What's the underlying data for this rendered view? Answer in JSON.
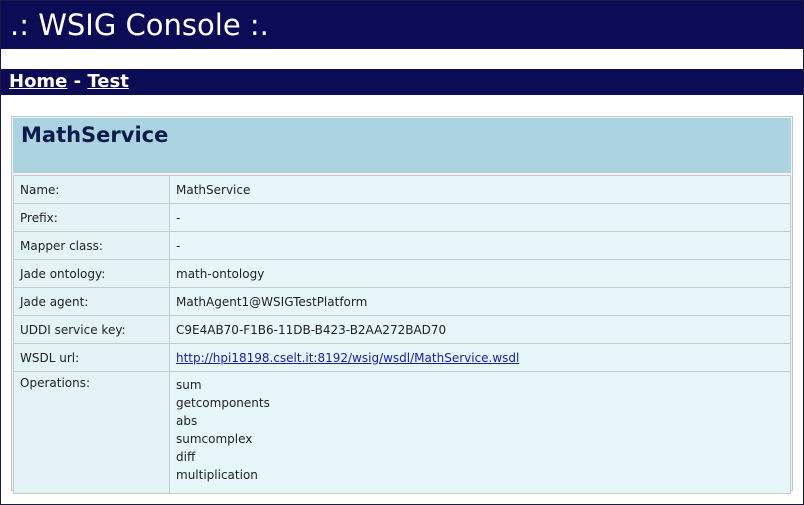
{
  "header": {
    "title": ".: WSIG Console :."
  },
  "nav": {
    "home": "Home",
    "separator": " - ",
    "test": "Test"
  },
  "service": {
    "title": "MathService",
    "rows": [
      {
        "label": "Name:",
        "value": "MathService"
      },
      {
        "label": "Prefix:",
        "value": "-"
      },
      {
        "label": "Mapper class:",
        "value": "-"
      },
      {
        "label": "Jade ontology:",
        "value": "math-ontology"
      },
      {
        "label": "Jade agent:",
        "value": "MathAgent1@WSIGTestPlatform"
      },
      {
        "label": "UDDI service key:",
        "value": "C9E4AB70-F1B6-11DB-B423-B2AA272BAD70"
      },
      {
        "label": "WSDL url:",
        "value": "http://hpi18198.cselt.it:8192/wsig/wsdl/MathService.wsdl"
      }
    ],
    "operations_label": "Operations:",
    "operations": [
      "sum",
      "getcomponents",
      "abs",
      "sumcomplex",
      "diff",
      "multiplication"
    ]
  }
}
